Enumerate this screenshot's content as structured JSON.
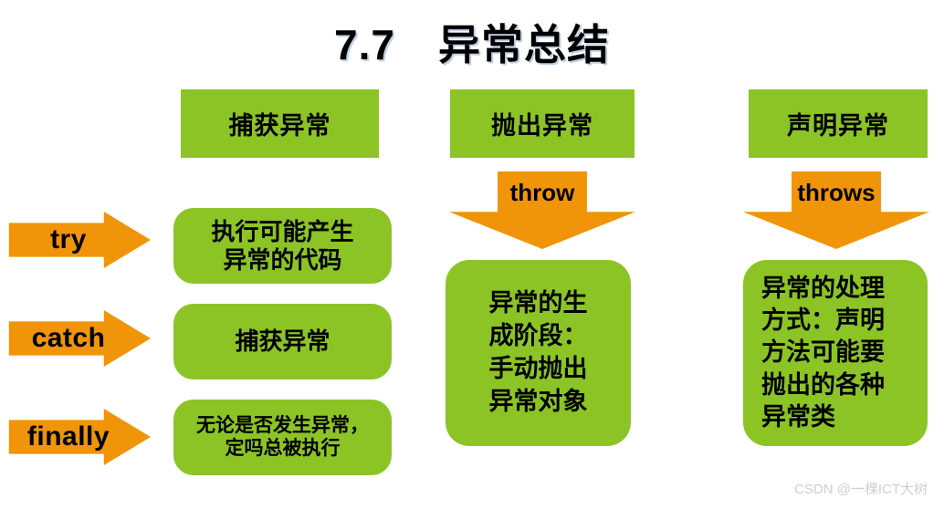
{
  "slide": {
    "title": "7.7　异常总结",
    "background_color": "#FFFFFF",
    "green_color": "#8CC425",
    "orange_color": "#F0940A",
    "text_color": "#000000"
  },
  "columns": [
    {
      "header": "捕获异常",
      "steps": [
        {
          "keyword": "try",
          "description": "执行可能产生\n异常的代码"
        },
        {
          "keyword": "catch",
          "description": "捕获异常"
        },
        {
          "keyword": "finally",
          "description": "无论是否发生异常，\n定吗总被执行"
        }
      ]
    },
    {
      "header": "抛出异常",
      "arrow_label": "throw",
      "detail": "异常的生\n成阶段：\n手动抛出\n异常对象"
    },
    {
      "header": "声明异常",
      "arrow_label": "throws",
      "detail": "异常的处理\n方式：声明\n方法可能要\n抛出的各种\n异常类"
    }
  ],
  "watermark": {
    "front": "CSDN @一棵",
    "back": "ICT大树"
  }
}
